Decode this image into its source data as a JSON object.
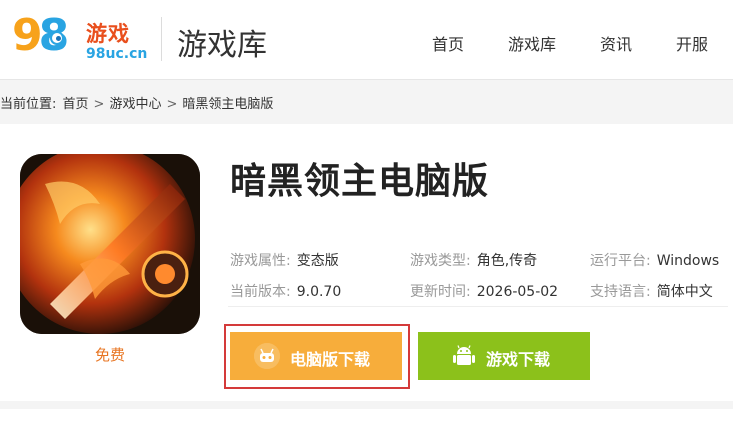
{
  "header": {
    "logo_main": "98",
    "logo_cn": "游戏",
    "logo_domain": "98uc.cn",
    "section_title": "游戏库",
    "nav": [
      "首页",
      "游戏库",
      "资讯",
      "开服"
    ]
  },
  "breadcrumb": {
    "prefix": "当前位置:",
    "items": [
      "首页",
      "游戏中心",
      "暗黑领主电脑版"
    ],
    "separator": ">"
  },
  "game": {
    "title": "暗黑领主电脑版",
    "price": "免费",
    "info": [
      {
        "key": "游戏属性:",
        "value": "变态版"
      },
      {
        "key": "游戏类型:",
        "value": "角色,传奇"
      },
      {
        "key": "运行平台:",
        "value": "Windows"
      },
      {
        "key": "当前版本:",
        "value": "9.0.70"
      },
      {
        "key": "更新时间:",
        "value": "2026-05-02"
      },
      {
        "key": "支持语言:",
        "value": "简体中文"
      }
    ]
  },
  "buttons": {
    "pc_download": "电脑版下载",
    "game_download": "游戏下载"
  },
  "colors": {
    "pc_button": "#f7ad3b",
    "game_button": "#8cc11b",
    "highlight_frame": "#d43a3a",
    "price": "#e87522"
  }
}
